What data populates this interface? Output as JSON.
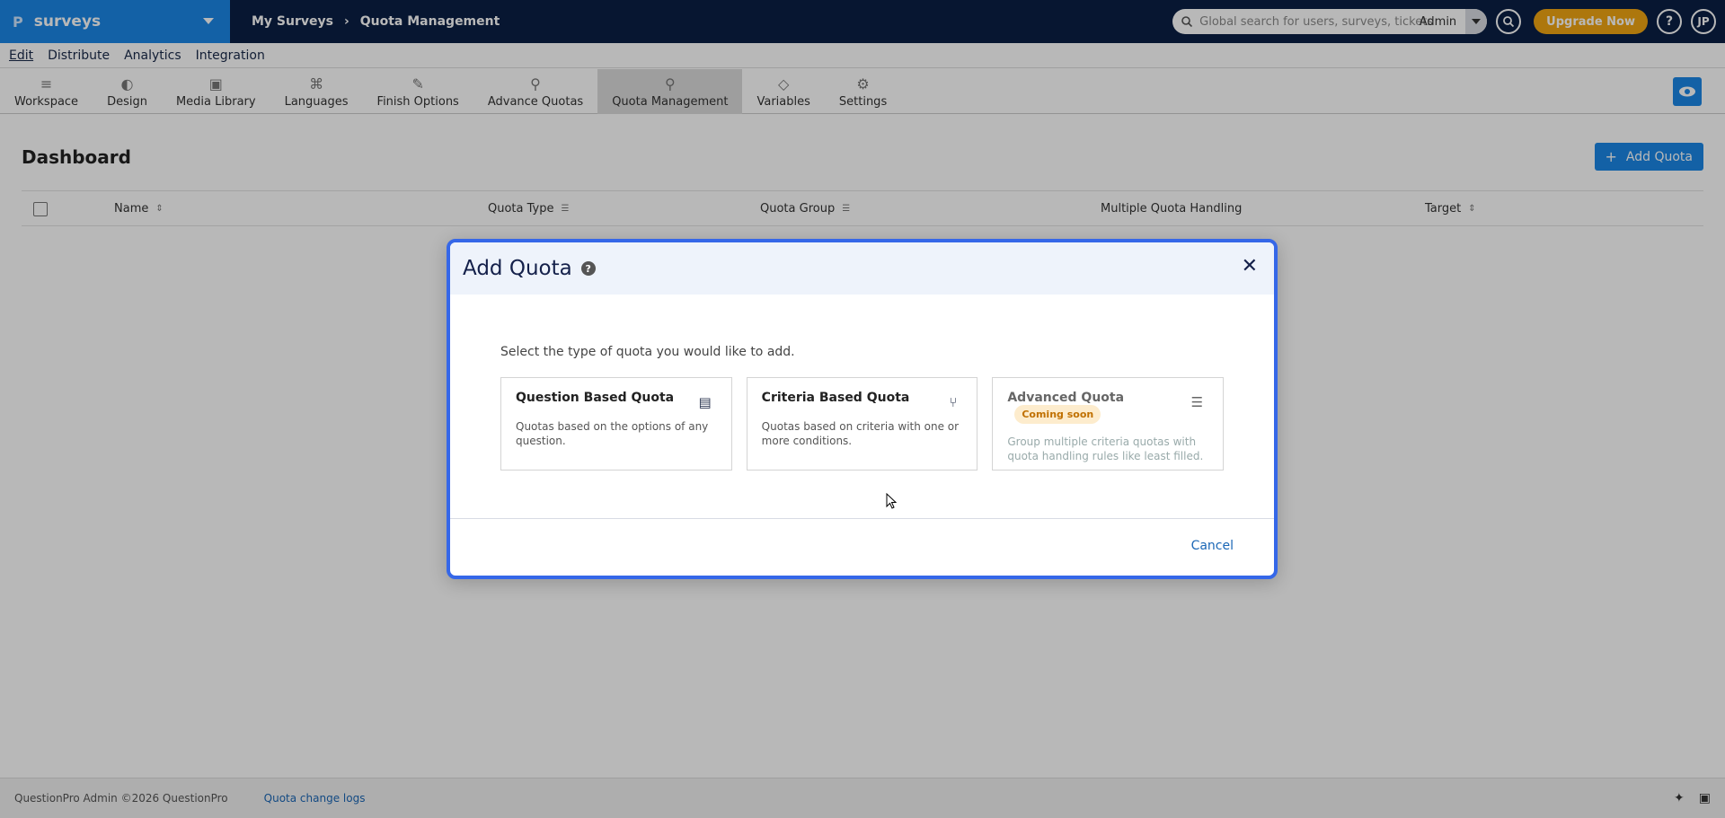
{
  "topbar": {
    "brand_logo": "P",
    "brand_name": "surveys",
    "breadcrumb": [
      "My Surveys",
      "Quota Management"
    ],
    "search_placeholder": "Global search for users, surveys, tickets",
    "search_scope": "Admin",
    "upgrade_label": "Upgrade Now",
    "help_label": "?",
    "avatar_initials": "JP"
  },
  "menu": [
    "Edit",
    "Distribute",
    "Analytics",
    "Integration"
  ],
  "toolbar": [
    {
      "label": "Workspace",
      "icon": "≡"
    },
    {
      "label": "Design",
      "icon": "◐"
    },
    {
      "label": "Media Library",
      "icon": "▣"
    },
    {
      "label": "Languages",
      "icon": "⌘"
    },
    {
      "label": "Finish Options",
      "icon": "✎"
    },
    {
      "label": "Advance Quotas",
      "icon": "⚲"
    },
    {
      "label": "Quota Management",
      "icon": "⚲"
    },
    {
      "label": "Variables",
      "icon": "◇"
    },
    {
      "label": "Settings",
      "icon": "⚙"
    }
  ],
  "dashboard": {
    "title": "Dashboard",
    "add_button": "Add Quota",
    "columns": [
      "Name",
      "Quota Type",
      "Quota Group",
      "Multiple Quota Handling",
      "Target"
    ]
  },
  "modal": {
    "title": "Add Quota",
    "lead": "Select the type of quota you would like to add.",
    "cards": [
      {
        "title": "Question Based Quota",
        "desc": "Quotas based on the options of any question.",
        "icon": "▤"
      },
      {
        "title": "Criteria Based Quota",
        "desc": "Quotas based on criteria with one or more conditions.",
        "icon": "⑂"
      },
      {
        "title": "Advanced Quota",
        "badge": "Coming soon",
        "desc": "Group multiple criteria quotas with quota handling rules like least filled.",
        "icon": "☰"
      }
    ],
    "cancel": "Cancel"
  },
  "footer": {
    "copyright": "QuestionPro Admin ©2026 QuestionPro",
    "link": "Quota change logs"
  },
  "colors": {
    "accent": "#1b87e6",
    "nav": "#0a1f44",
    "upgrade": "#f0a513",
    "modal_border": "#3567e8"
  }
}
